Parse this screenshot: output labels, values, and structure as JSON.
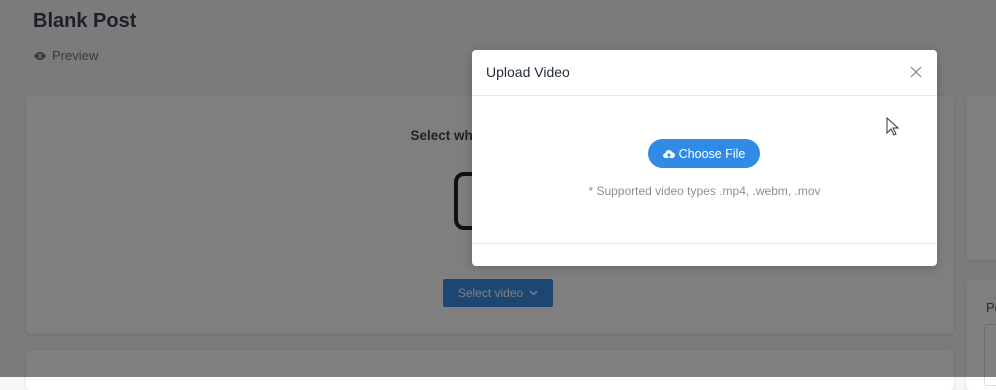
{
  "page": {
    "title": "Blank Post",
    "preview_label": "Preview"
  },
  "main_card": {
    "prompt": "Select what media you w",
    "select_button_label": "Select video"
  },
  "right_card": {
    "label": "Po"
  },
  "modal": {
    "title": "Upload Video",
    "choose_file_label": "Choose File",
    "supported_text": "* Supported video types .mp4, .webm, .mov"
  },
  "icons": {
    "preview": "eye-icon",
    "choose_file": "cloud-upload-icon",
    "select_dropdown": "chevron-down-icon",
    "close": "close-icon",
    "cursor": "mouse-cursor-icon"
  },
  "colors": {
    "primary": "#2f8be6",
    "overlay": "rgba(0,0,0,0.5)",
    "page_title": "#3a4150"
  }
}
